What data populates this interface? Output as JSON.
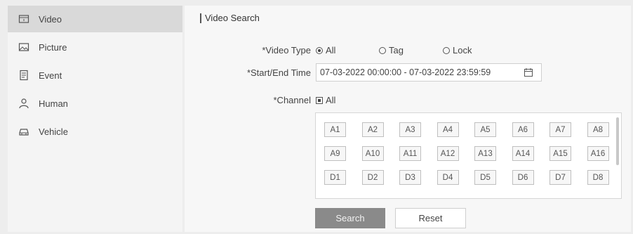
{
  "sidebar": {
    "items": [
      {
        "label": "Video",
        "icon": "video-icon",
        "active": true
      },
      {
        "label": "Picture",
        "icon": "picture-icon"
      },
      {
        "label": "Event",
        "icon": "event-icon"
      },
      {
        "label": "Human",
        "icon": "human-icon"
      },
      {
        "label": "Vehicle",
        "icon": "vehicle-icon"
      }
    ]
  },
  "main": {
    "title": "Video Search",
    "video_type": {
      "label": "*Video Type",
      "options": [
        {
          "label": "All",
          "selected": true
        },
        {
          "label": "Tag",
          "selected": false
        },
        {
          "label": "Lock",
          "selected": false
        }
      ]
    },
    "time": {
      "label": "*Start/End Time",
      "value": "07-03-2022 00:00:00 - 07-03-2022 23:59:59"
    },
    "channel": {
      "label": "*Channel",
      "all_label": "All",
      "all_checked": true,
      "channels": [
        "A1",
        "A2",
        "A3",
        "A4",
        "A5",
        "A6",
        "A7",
        "A8",
        "A9",
        "A10",
        "A11",
        "A12",
        "A13",
        "A14",
        "A15",
        "A16",
        "D1",
        "D2",
        "D3",
        "D4",
        "D5",
        "D6",
        "D7",
        "D8"
      ]
    },
    "buttons": {
      "search": "Search",
      "reset": "Reset"
    }
  },
  "colors": {
    "active_nav": "#d9d9d9",
    "search_button": "#8a8a8a"
  }
}
